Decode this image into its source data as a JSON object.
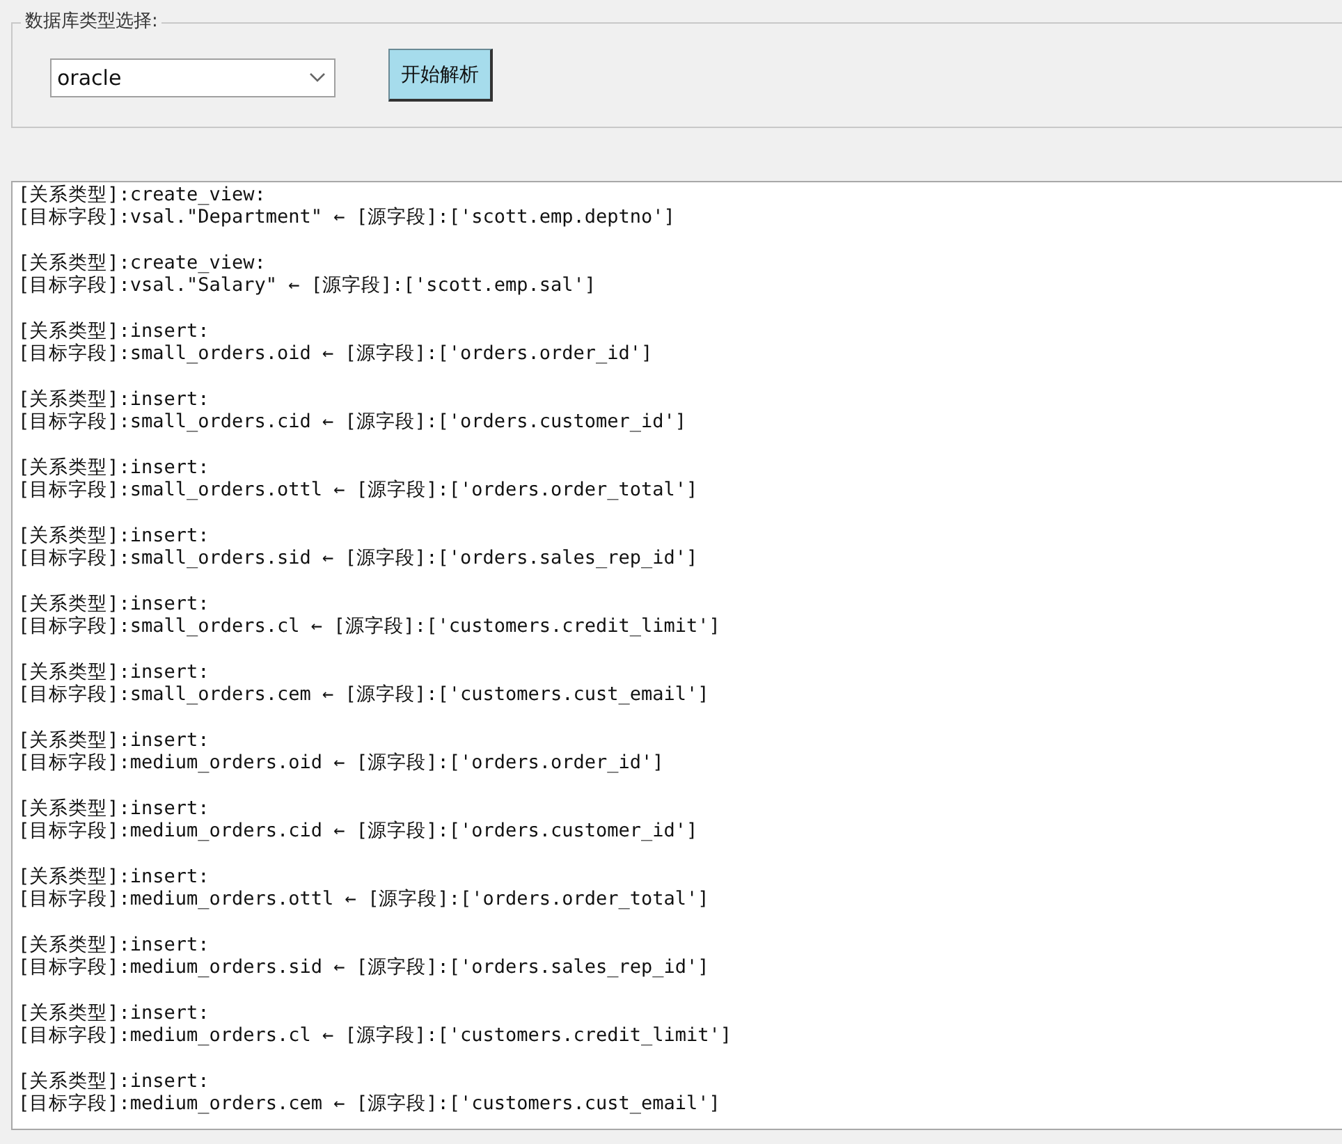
{
  "group": {
    "title": "数据库类型选择:",
    "db_select": {
      "value": "oracle"
    },
    "button": "开始解析"
  },
  "output": [
    {
      "relation": "[关系类型]:create_view:",
      "mapping": "[目标字段]:vsal.\"Department\" ← [源字段]:['scott.emp.deptno']"
    },
    {
      "relation": "[关系类型]:create_view:",
      "mapping": "[目标字段]:vsal.\"Salary\" ← [源字段]:['scott.emp.sal']"
    },
    {
      "relation": "[关系类型]:insert:",
      "mapping": "[目标字段]:small_orders.oid ← [源字段]:['orders.order_id']"
    },
    {
      "relation": "[关系类型]:insert:",
      "mapping": "[目标字段]:small_orders.cid ← [源字段]:['orders.customer_id']"
    },
    {
      "relation": "[关系类型]:insert:",
      "mapping": "[目标字段]:small_orders.ottl ← [源字段]:['orders.order_total']"
    },
    {
      "relation": "[关系类型]:insert:",
      "mapping": "[目标字段]:small_orders.sid ← [源字段]:['orders.sales_rep_id']"
    },
    {
      "relation": "[关系类型]:insert:",
      "mapping": "[目标字段]:small_orders.cl ← [源字段]:['customers.credit_limit']"
    },
    {
      "relation": "[关系类型]:insert:",
      "mapping": "[目标字段]:small_orders.cem ← [源字段]:['customers.cust_email']"
    },
    {
      "relation": "[关系类型]:insert:",
      "mapping": "[目标字段]:medium_orders.oid ← [源字段]:['orders.order_id']"
    },
    {
      "relation": "[关系类型]:insert:",
      "mapping": "[目标字段]:medium_orders.cid ← [源字段]:['orders.customer_id']"
    },
    {
      "relation": "[关系类型]:insert:",
      "mapping": "[目标字段]:medium_orders.ottl ← [源字段]:['orders.order_total']"
    },
    {
      "relation": "[关系类型]:insert:",
      "mapping": "[目标字段]:medium_orders.sid ← [源字段]:['orders.sales_rep_id']"
    },
    {
      "relation": "[关系类型]:insert:",
      "mapping": "[目标字段]:medium_orders.cl ← [源字段]:['customers.credit_limit']"
    },
    {
      "relation": "[关系类型]:insert:",
      "mapping": "[目标字段]:medium_orders.cem ← [源字段]:['customers.cust_email']"
    }
  ]
}
